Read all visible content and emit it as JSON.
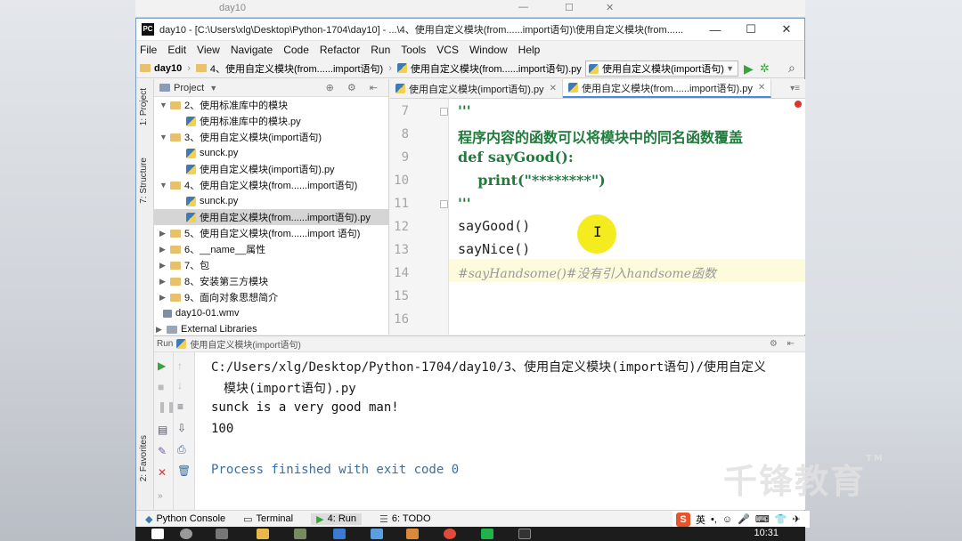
{
  "background": {
    "top_title": "day10"
  },
  "window": {
    "title": "day10 - [C:\\Users\\xlg\\Desktop\\Python-1704\\day10] - ...\\4、使用自定义模块(from......import语句)\\使用自定义模块(from......",
    "app_icon": "PC"
  },
  "menu": [
    "File",
    "Edit",
    "View",
    "Navigate",
    "Code",
    "Refactor",
    "Run",
    "Tools",
    "VCS",
    "Window",
    "Help"
  ],
  "breadcrumb": {
    "project": "day10",
    "folder": "4、使用自定义模块(from......import语句)",
    "file": "使用自定义模块(from......import语句).py"
  },
  "run_config": "使用自定义模块(import语句)",
  "left_tabs": {
    "project": "1: Project",
    "structure": "7: Structure",
    "favorites": "2: Favorites"
  },
  "project_panel": {
    "header": "Project",
    "tree": [
      {
        "label": "2、使用标准库中的模块",
        "type": "folder",
        "indent": 0,
        "expanded": true
      },
      {
        "label": "使用标准库中的模块.py",
        "type": "py",
        "indent": 1
      },
      {
        "label": "3、使用自定义模块(import语句)",
        "type": "folder",
        "indent": 0,
        "expanded": true
      },
      {
        "label": "sunck.py",
        "type": "py",
        "indent": 1
      },
      {
        "label": "使用自定义模块(import语句).py",
        "type": "py",
        "indent": 1
      },
      {
        "label": "4、使用自定义模块(from......import语句)",
        "type": "folder",
        "indent": 0,
        "expanded": true
      },
      {
        "label": "sunck.py",
        "type": "py",
        "indent": 1
      },
      {
        "label": "使用自定义模块(from......import语句).py",
        "type": "py",
        "indent": 1,
        "selected": true
      },
      {
        "label": "5、使用自定义模块(from......import 语句)",
        "type": "folder",
        "indent": 0
      },
      {
        "label": "6、__name__属性",
        "type": "folder",
        "indent": 0
      },
      {
        "label": "7、包",
        "type": "folder",
        "indent": 0
      },
      {
        "label": "8、安装第三方模块",
        "type": "folder",
        "indent": 0
      },
      {
        "label": "9、面向对象思想简介",
        "type": "folder",
        "indent": 0
      },
      {
        "label": "day10-01.wmv",
        "type": "file",
        "indent": 0
      },
      {
        "label": "External Libraries",
        "type": "lib",
        "indent": -1
      }
    ]
  },
  "editor": {
    "tabs": [
      {
        "label": "使用自定义模块(import语句).py",
        "active": false
      },
      {
        "label": "使用自定义模块(from......import语句).py",
        "active": true
      }
    ],
    "lines": [
      {
        "num": "7",
        "text": "'''",
        "style": "str"
      },
      {
        "num": "8",
        "text": "程序内容的函数可以将模块中的同名函数覆盖",
        "style": "str"
      },
      {
        "num": "9",
        "text": "def sayGood():",
        "style": "str"
      },
      {
        "num": "10",
        "text": "    print(\"********\")",
        "style": "str"
      },
      {
        "num": "11",
        "text": "'''",
        "style": "str"
      },
      {
        "num": "12",
        "text": "sayGood()",
        "style": "plain"
      },
      {
        "num": "13",
        "text": "sayNice()",
        "style": "plain"
      },
      {
        "num": "14",
        "text": "#sayHandsome()#没有引入handsome函数",
        "style": "comment"
      },
      {
        "num": "15",
        "text": "",
        "style": "plain"
      },
      {
        "num": "16",
        "text": "",
        "style": "plain"
      }
    ]
  },
  "run_panel": {
    "header": "Run",
    "config": "使用自定义模块(import语句)",
    "output": [
      "C:/Users/xlg/Desktop/Python-1704/day10/3、使用自定义模块(import语句)/使用自定义",
      "模块(import语句).py",
      "sunck is a very good man!",
      "100",
      "Process finished with exit code 0"
    ]
  },
  "status_bar": {
    "items": [
      "Python Console",
      "Terminal",
      "4: Run",
      "6: TODO"
    ],
    "ime": "英"
  },
  "watermark": "千锋教育",
  "watermark_tm": "TM",
  "clock": "10:31"
}
